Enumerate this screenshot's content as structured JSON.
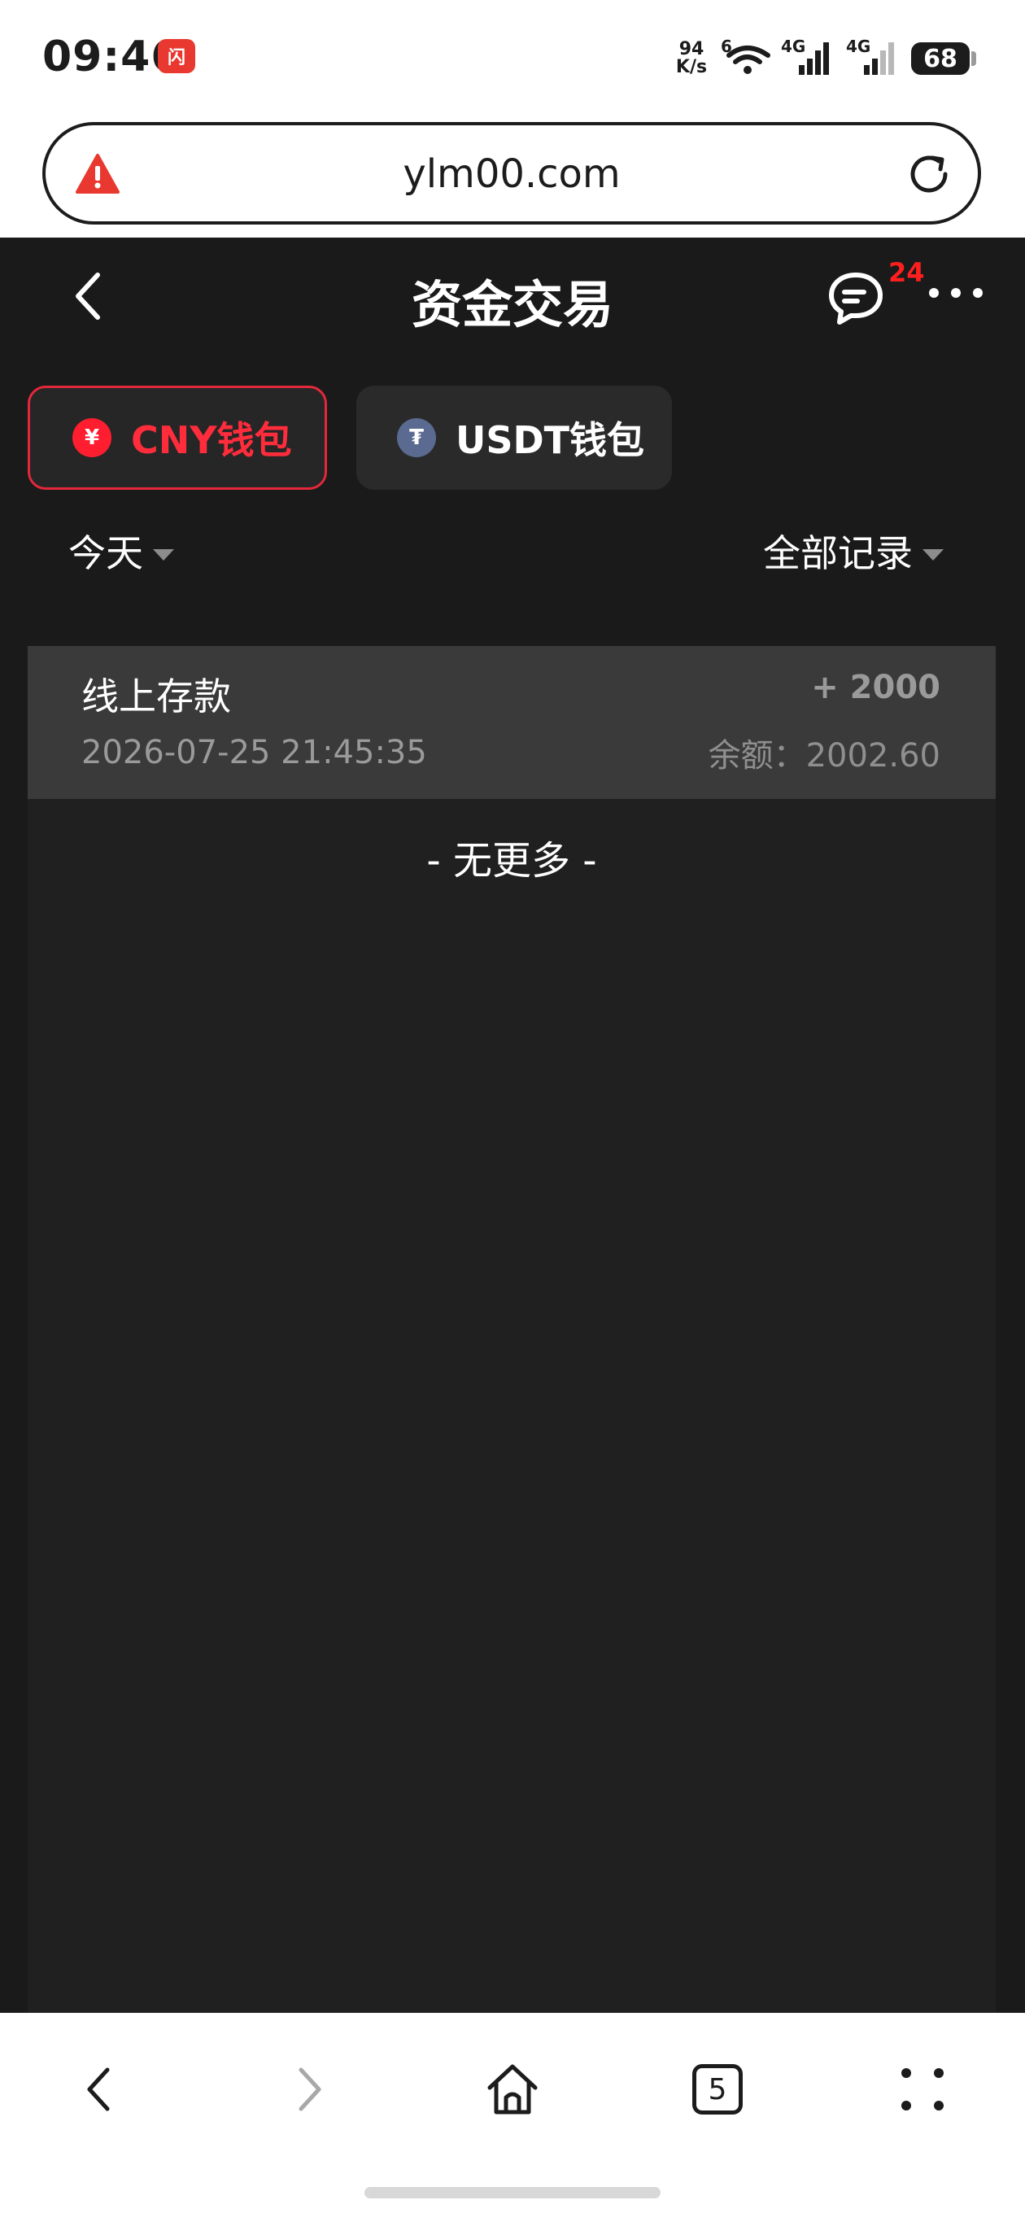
{
  "status_bar": {
    "time": "09:46",
    "app_badge": "闪",
    "net_speed_value": "94",
    "net_speed_unit": "K/s",
    "wifi_label": "6",
    "signal_1": "4G",
    "signal_2": "4G",
    "battery": "68"
  },
  "browser": {
    "url": "ylm00.com",
    "tab_count": "5"
  },
  "header": {
    "title": "资金交易",
    "message_badge": "24"
  },
  "wallet_tabs": [
    {
      "label": "CNY钱包",
      "coin_symbol": "¥",
      "active": true
    },
    {
      "label": "USDT钱包",
      "coin_symbol": "₮",
      "active": false
    }
  ],
  "filters": {
    "date": "今天",
    "type": "全部记录"
  },
  "records": [
    {
      "title": "线上存款",
      "time": "2026-07-25 21:45:35",
      "amount": "+ 2000",
      "balance": "余额：2002.60"
    }
  ],
  "no_more": "- 无更多 -",
  "colors": {
    "accent": "#ff2c3c",
    "background": "#1a1a1a",
    "panel": "#202020",
    "record": "#3a3a3a"
  }
}
